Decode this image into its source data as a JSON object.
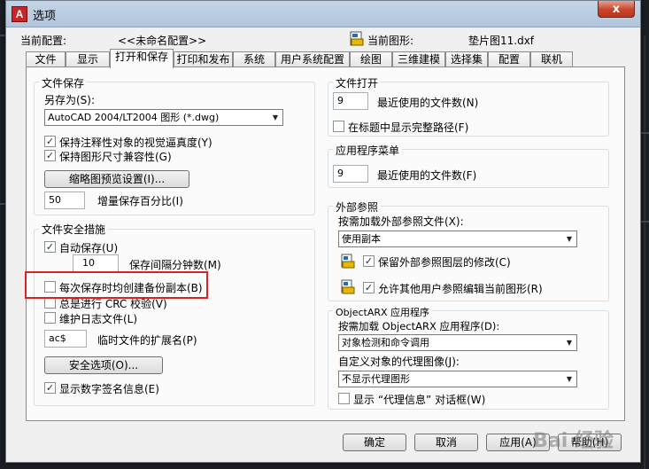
{
  "window": {
    "app_icon_letter": "A",
    "title": "选项",
    "close_label": "x"
  },
  "profile": {
    "label": "当前配置:",
    "value": "<<未命名配置>>",
    "drawing_label": "当前图形:",
    "drawing_value": "垫片图11.dxf"
  },
  "tabs": [
    "文件",
    "显示",
    "打开和保存",
    "打印和发布",
    "系统",
    "用户系统配置",
    "绘图",
    "三维建模",
    "选择集",
    "配置",
    "联机"
  ],
  "active_tab": "打开和保存",
  "file_save": {
    "title": "文件保存",
    "save_as_label": "另存为(S):",
    "save_as_value": "AutoCAD 2004/LT2004 图形 (*.dwg)",
    "keep_visual_fidelity": "保持注释性对象的视觉逼真度(Y)",
    "keep_drawing_size": "保持图形尺寸兼容性(G)",
    "thumbnail_button": "缩略图预览设置(I)...",
    "incremental_value": "50",
    "incremental_label": "增量保存百分比(I)"
  },
  "file_safety": {
    "title": "文件安全措施",
    "autosave_label": "自动保存(U)",
    "autosave_minutes": "10",
    "autosave_minutes_label": "保存间隔分钟数(M)",
    "backup_label": "每次保存时均创建备份副本(B)",
    "crc_label": "总是进行 CRC 校验(V)",
    "log_label": "维护日志文件(L)",
    "temp_ext_value": "ac$",
    "temp_ext_label": "临时文件的扩展名(P)",
    "security_button": "安全选项(O)...",
    "digital_sig_label": "显示数字签名信息(E)"
  },
  "file_open": {
    "title": "文件打开",
    "recent_value": "9",
    "recent_label": "最近使用的文件数(N)",
    "full_path_label": "在标题中显示完整路径(F)"
  },
  "app_menu": {
    "title": "应用程序菜单",
    "recent_value": "9",
    "recent_label": "最近使用的文件数(F)"
  },
  "xref": {
    "title": "外部参照",
    "demand_load_label": "按需加载外部参照文件(X):",
    "demand_load_value": "使用副本",
    "retain_changes_label": "保留外部参照图层的修改(C)",
    "allow_edit_label": "允许其他用户参照编辑当前图形(R)"
  },
  "objectarx": {
    "title": "ObjectARX 应用程序",
    "demand_load_label": "按需加载 ObjectARX 应用程序(D):",
    "demand_load_value": "对象检测和命令调用",
    "proxy_images_label": "自定义对象的代理图像(J):",
    "proxy_images_value": "不显示代理图形",
    "proxy_dialog_label": "显示 “代理信息” 对话框(W)"
  },
  "buttons": {
    "ok": "确定",
    "cancel": "取消",
    "apply": "应用(A)",
    "help": "帮助(H)"
  },
  "watermark": "Bai 经验",
  "colors": {
    "highlight": "#e02020",
    "titlebar": "#b2c6dc"
  }
}
